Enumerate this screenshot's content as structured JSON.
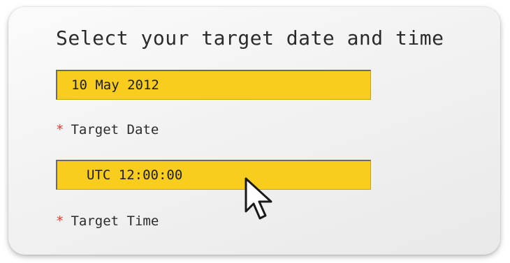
{
  "panel": {
    "title": "Select your target date and time"
  },
  "date_field": {
    "value": "10 May 2012",
    "label": "Target Date",
    "required_marker": "*"
  },
  "time_field": {
    "value": "UTC 12:00:00",
    "label": "Target Time",
    "required_marker": "*"
  },
  "colors": {
    "field_fill": "#f9cd1e",
    "required_marker": "#e23a2a",
    "text": "#2b2b2b"
  },
  "icons": {
    "pointer": "mouse-pointer-icon"
  }
}
